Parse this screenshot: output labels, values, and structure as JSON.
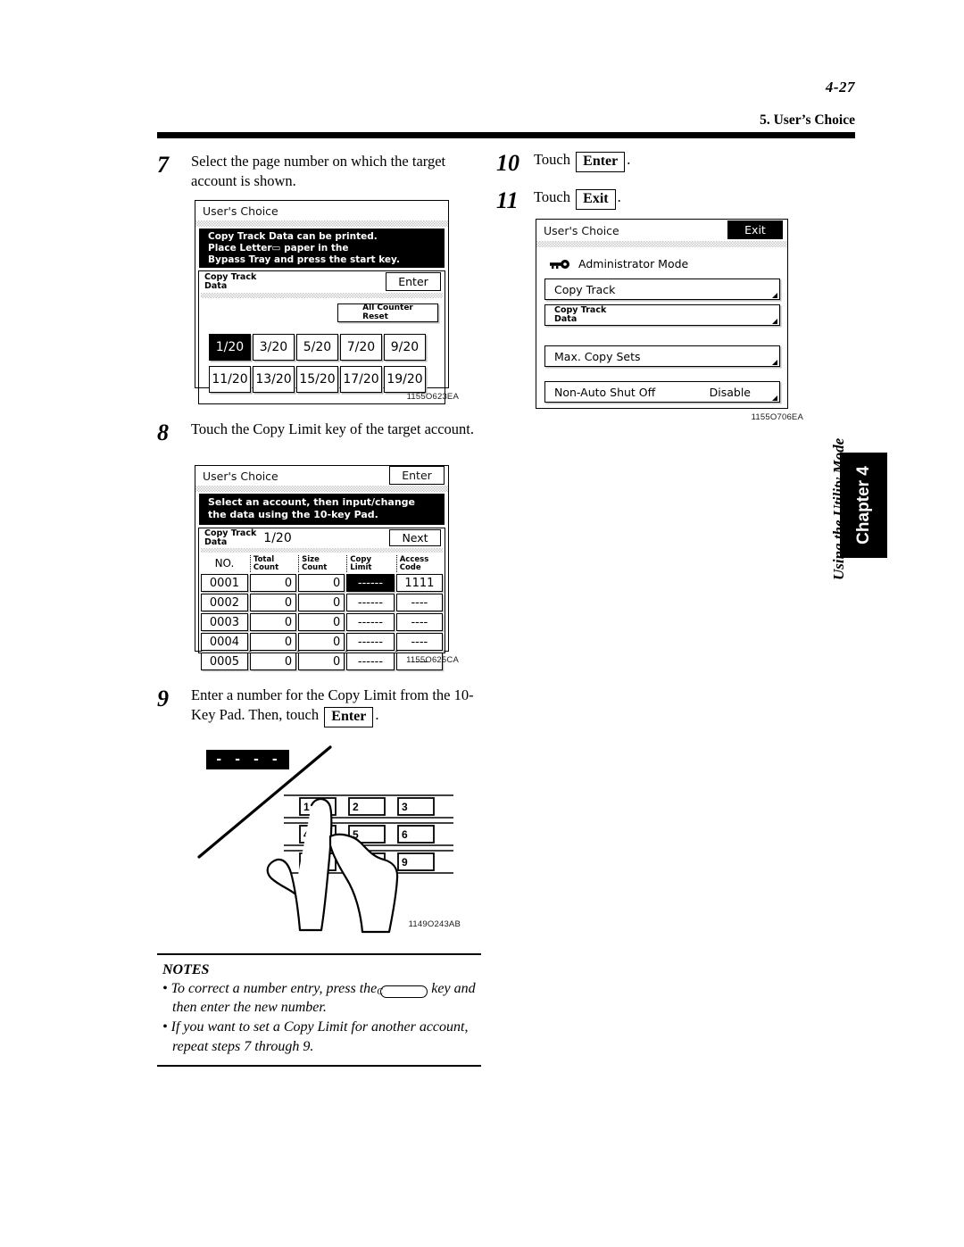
{
  "header": {
    "page_number": "4-27",
    "section_title": "5. User’s Choice"
  },
  "chapter_tab": {
    "label": "Chapter 4",
    "subtitle": "Using the Utility Mode"
  },
  "steps": [
    {
      "number": "7",
      "text": "Select the page number on which the target account is shown."
    },
    {
      "number": "8",
      "text": "Touch the Copy Limit key of the target account."
    },
    {
      "number": "9",
      "text_before": "Enter a number for the Copy Limit from the 10-Key Pad. Then, touch",
      "key": "Enter",
      "text_after": "."
    },
    {
      "number": "10",
      "text_before": "Touch",
      "key": "Enter",
      "text_after": "."
    },
    {
      "number": "11",
      "text_before": "Touch",
      "key": "Exit",
      "text_after": "."
    }
  ],
  "figure_copy_track_pages": {
    "code": "1155O623EA",
    "title": "User's Choice",
    "message_lines": [
      "Copy Track Data can be printed.",
      "Place Letter▭ paper in the",
      "Bypass Tray and press the start key."
    ],
    "section_label": "Copy Track\nData",
    "enter_button": "Enter",
    "all_counter_reset_button": "All Counter\nReset",
    "page_keys_row1": [
      "1/20",
      "3/20",
      "5/20",
      "7/20",
      "9/20"
    ],
    "page_keys_row2": [
      "11/20",
      "13/20",
      "15/20",
      "17/20",
      "19/20"
    ],
    "selected_page_key": "1/20"
  },
  "figure_copy_track_table": {
    "code": "1155O625CA",
    "title": "User's Choice",
    "enter_button": "Enter",
    "message_lines": [
      "Select an account, then input/change",
      "the data using the 10-key Pad."
    ],
    "section_label": "Copy Track\nData",
    "page_indicator": "1/20",
    "next_button": "Next",
    "columns": [
      "NO.",
      "Total\nCount",
      "Size\nCount",
      "Copy\nLimit",
      "Access\nCode"
    ],
    "rows": [
      {
        "no": "0001",
        "total_count": "0",
        "size_count": "0",
        "copy_limit": "------",
        "access_code": "1111",
        "selected": "copy_limit"
      },
      {
        "no": "0002",
        "total_count": "0",
        "size_count": "0",
        "copy_limit": "------",
        "access_code": "----",
        "selected": ""
      },
      {
        "no": "0003",
        "total_count": "0",
        "size_count": "0",
        "copy_limit": "------",
        "access_code": "----",
        "selected": ""
      },
      {
        "no": "0004",
        "total_count": "0",
        "size_count": "0",
        "copy_limit": "------",
        "access_code": "----",
        "selected": ""
      },
      {
        "no": "0005",
        "total_count": "0",
        "size_count": "0",
        "copy_limit": "------",
        "access_code": "----",
        "selected": ""
      }
    ]
  },
  "figure_admin_mode": {
    "code": "1155O706EA",
    "title": "User's Choice",
    "exit_button": "Exit",
    "mode_label": "Administrator Mode",
    "mode_icon": "key-icon",
    "items": [
      {
        "label": "Copy Track",
        "value": ""
      },
      {
        "label": "Copy Track\nData",
        "value": ""
      },
      {
        "label": "Max. Copy Sets",
        "value": ""
      },
      {
        "label": "Non-Auto Shut Off",
        "value": "Disable"
      }
    ]
  },
  "figure_keypad": {
    "code": "1149O243AB",
    "display_value": "- - - -",
    "keys": [
      "1",
      "2",
      "3",
      "4",
      "5",
      "6",
      "7",
      "",
      "9"
    ]
  },
  "notes": {
    "title": "NOTES",
    "items": [
      {
        "before": "To correct a number entry, press the",
        "key": "C",
        "after": "key and then enter the new number."
      },
      {
        "before": "If you want to set a Copy Limit for another account, repeat steps 7 through 9.",
        "key": "",
        "after": ""
      }
    ]
  }
}
